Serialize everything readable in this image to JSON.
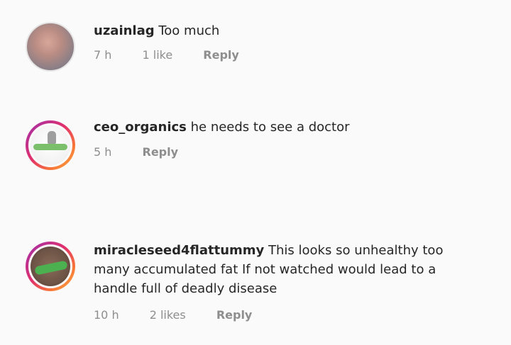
{
  "comments": [
    {
      "username": "uzainlag",
      "text": "Too much",
      "time": "7 h",
      "likes": "1 like",
      "reply": "Reply"
    },
    {
      "username": "ceo_organics",
      "text": "he needs to see a doctor",
      "time": "5 h",
      "reply": "Reply"
    },
    {
      "username": "miracleseed4flattummy",
      "text": "This looks so unhealthy too many accumulated fat If not watched would lead to a handle full of deadly disease",
      "time": "10 h",
      "likes": "2 likes",
      "reply": "Reply"
    }
  ]
}
